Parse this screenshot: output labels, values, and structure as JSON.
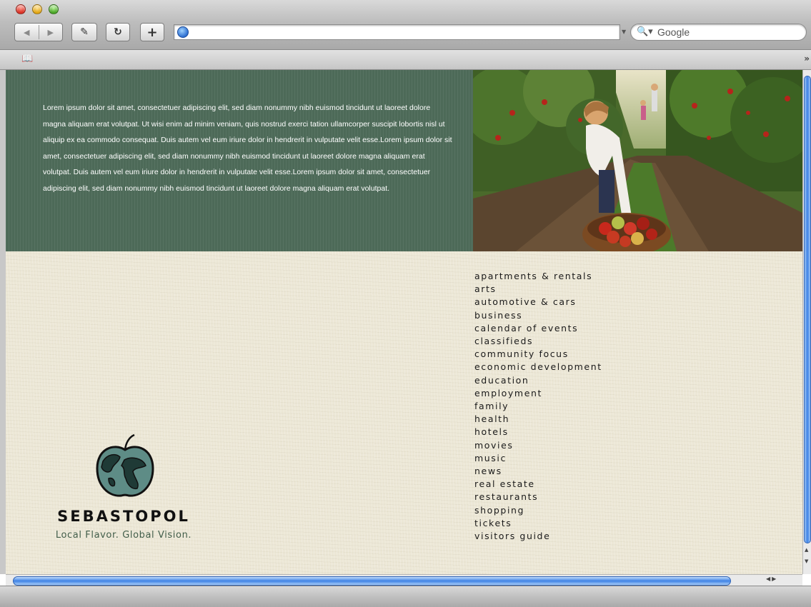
{
  "browser": {
    "url": "",
    "search_placeholder": "Google",
    "icons": [
      "back-forward",
      "edit-icon",
      "reload-icon",
      "add-bookmark-icon",
      "globe-icon",
      "search-icon",
      "bookmarks-icon",
      "chevron-right-icon"
    ]
  },
  "page": {
    "intro_text": "Lorem ipsum dolor sit amet, consectetuer adipiscing elit, sed diam nonummy nibh euismod tincidunt ut laoreet dolore magna aliquam erat volutpat.  Ut wisi enim ad minim veniam, quis nostrud exerci tation ullamcorper suscipit lobortis nisl ut aliquip ex ea commodo consequat.  Duis autem vel eum iriure dolor in hendrerit in vulputate velit esse.Lorem ipsum dolor sit amet, consectetuer adipiscing elit, sed diam nonummy nibh euismod tincidunt ut laoreet dolore magna aliquam erat volutpat.  Duis autem vel eum iriure dolor in hendrerit in vulputate velit esse.Lorem ipsum dolor sit amet, consectetuer adipiscing elit, sed diam nonummy nibh euismod tincidunt ut laoreet dolore magna aliquam erat volutpat.",
    "nav": [
      "apartments & rentals",
      "arts",
      "automotive & cars",
      "business",
      "calendar of events",
      "classifieds",
      "community focus",
      "economic development",
      "education",
      "employment",
      "family",
      "health",
      "hotels",
      "movies",
      "music",
      "news",
      "real estate",
      "restaurants",
      "shopping",
      "tickets",
      "visitors guide"
    ],
    "logo": {
      "name": "SEBASTOPOL",
      "tagline": "Local Flavor. Global Vision."
    }
  },
  "colors": {
    "panel_green": "#4d6a58",
    "page_bg": "#ece7d6",
    "tagline_green": "#425e4a"
  }
}
